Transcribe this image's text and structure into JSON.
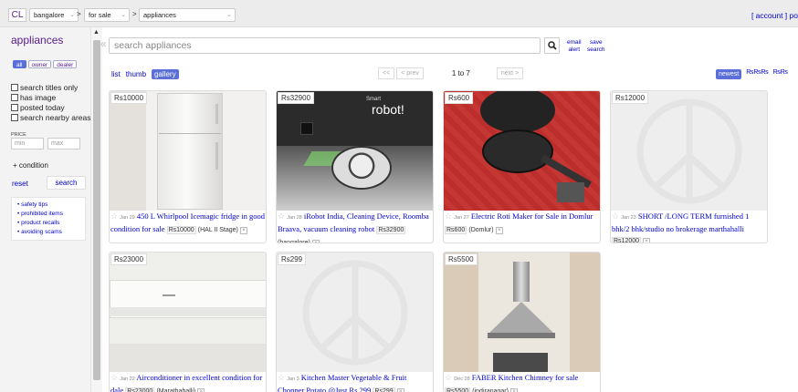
{
  "topbar": {
    "logo": "CL",
    "crumbs": [
      "bangalore",
      "for sale",
      "appliances"
    ],
    "separators": [
      ">",
      ">"
    ],
    "account": "[ account ] po"
  },
  "sidebar": {
    "title": "appliances",
    "seller_filters": [
      "all",
      "owner",
      "dealer"
    ],
    "checkboxes": [
      "search titles only",
      "has image",
      "posted today",
      "search nearby areas"
    ],
    "price_label": "PRICE",
    "min_placeholder": "min",
    "max_placeholder": "max",
    "condition": "+ condition",
    "reset": "reset",
    "search": "search",
    "links": [
      "• safety tips",
      "• prohibited items",
      "• product recalls",
      "• avoiding scams"
    ]
  },
  "search": {
    "collapse": "«",
    "placeholder": "search appliances",
    "email_alert": [
      "email",
      "alert"
    ],
    "save_search": [
      "save",
      "search"
    ]
  },
  "view": {
    "modes": [
      "list",
      "thumb",
      "gallery"
    ],
    "active_mode": "gallery",
    "pager": {
      "first": "<<",
      "prev": "< prev",
      "range": "1 to 7",
      "next": "next >"
    },
    "sort": [
      "newest",
      "₨₨₨",
      "₨₨"
    ]
  },
  "listings": [
    {
      "price": "Rs10000",
      "date": "Jan 29",
      "title": "450 L Whirlpool Icemagic fridge in good condition for sale",
      "price_tag": "Rs10000",
      "location": "(HAL II Stage)",
      "image": "fridge"
    },
    {
      "price": "Rs32900",
      "date": "Jan 28",
      "title": "iRobot India, Cleaning Device, Roomba Braava, vacuum cleaning robot",
      "price_tag": "Rs32900",
      "location": "(bangalore)",
      "image": "robot",
      "image_text": [
        "Smart",
        "robot!"
      ]
    },
    {
      "price": "Rs600",
      "date": "Jan 27",
      "title": "Electric Roti Maker for Sale in Domlur",
      "price_tag": "Rs600",
      "location": "(Domlur)",
      "image": "roti-maker"
    },
    {
      "price": "Rs12000",
      "date": "Jan 23",
      "title": "SHORT /LONG TERM furnished 1 bhk/2 bhk/studio no brokerage marthahalli",
      "price_tag": "Rs12000",
      "location": "",
      "image": "placeholder"
    },
    {
      "price": "Rs23000",
      "date": "Jan 22",
      "title": "Airconditioner in excellent condition for dale",
      "price_tag": "Rs23000",
      "location": "(Marathahalli)",
      "image": "air-conditioner"
    },
    {
      "price": "Rs299",
      "date": "Jan 3",
      "title": "Kitchen Master Vegetable & Fruit Chopper Potato @Just Rs.299",
      "price_tag": "Rs299",
      "location": "",
      "image": "placeholder"
    },
    {
      "price": "Rs5500",
      "date": "Dec 28",
      "title": "FABER Kitchen Chimney for sale",
      "price_tag": "Rs5500",
      "location": "(indiranagar)",
      "image": "chimney"
    }
  ],
  "colors": {
    "link": "#0000cc",
    "visited": "#551a8b",
    "accent": "#5a6fd8"
  }
}
